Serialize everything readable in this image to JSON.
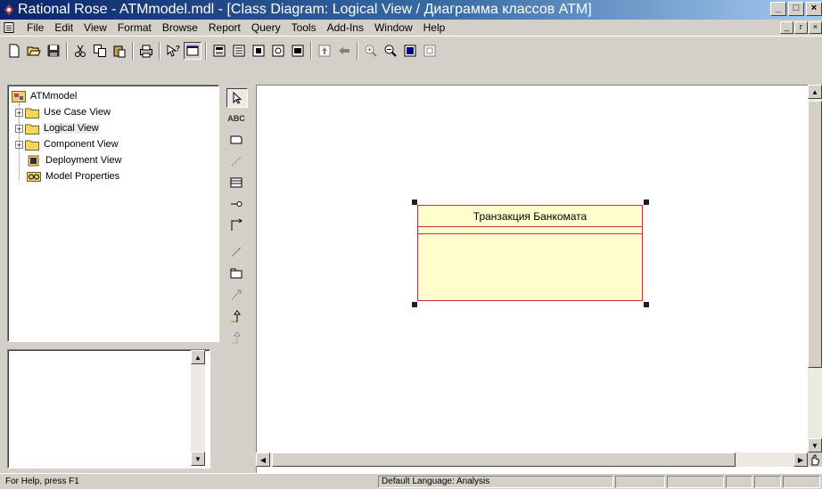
{
  "window": {
    "title": "Rational Rose - ATMmodel.mdl - [Class Diagram: Logical View / Диаграмма классов ATM]",
    "controls": [
      "_",
      "□",
      "×"
    ],
    "mdi_controls": [
      "_",
      "ᴦ",
      "×"
    ]
  },
  "menu": {
    "items": [
      "File",
      "Edit",
      "View",
      "Format",
      "Browse",
      "Report",
      "Query",
      "Tools",
      "Add-Ins",
      "Window",
      "Help"
    ]
  },
  "toolbar": {
    "icons": [
      "new-icon",
      "open-icon",
      "save-icon",
      "cut-icon",
      "copy-icon",
      "paste-icon",
      "print-icon",
      "context-help-icon",
      "view-documentation-icon",
      "browse-class-diagram-icon",
      "browse-interaction-diagram-icon",
      "browse-component-diagram-icon",
      "browse-deployment-diagram-icon",
      "browse-parent-icon",
      "browse-previous-icon",
      "zoom-in-icon",
      "zoom-out-icon",
      "fit-in-window-icon",
      "undo-fit-icon"
    ]
  },
  "browser": {
    "root": "ATMmodel",
    "items": [
      {
        "label": "Use Case View",
        "expandable": true
      },
      {
        "label": "Logical View",
        "expandable": true,
        "selected": true
      },
      {
        "label": "Component View",
        "expandable": true
      },
      {
        "label": "Deployment View",
        "expandable": false
      },
      {
        "label": "Model Properties",
        "expandable": false
      }
    ]
  },
  "toolbox": {
    "tools": [
      "selection-tool",
      "text-tool",
      "note-tool",
      "anchor-note-tool",
      "class-tool",
      "interface-tool",
      "association-tool",
      "aggregation-tool",
      "package-tool",
      "dependency-tool",
      "generalization-tool",
      "realization-tool"
    ],
    "text_tool_label": "ABC"
  },
  "diagram": {
    "class_name": "Транзакция Банкомата"
  },
  "status": {
    "help": "For Help, press F1",
    "language": "Default Language: Analysis"
  },
  "colors": {
    "title_gradient_start": "#0a246a",
    "title_gradient_end": "#a6caf0",
    "class_fill": "#ffffcc",
    "class_border": "#c03040"
  }
}
